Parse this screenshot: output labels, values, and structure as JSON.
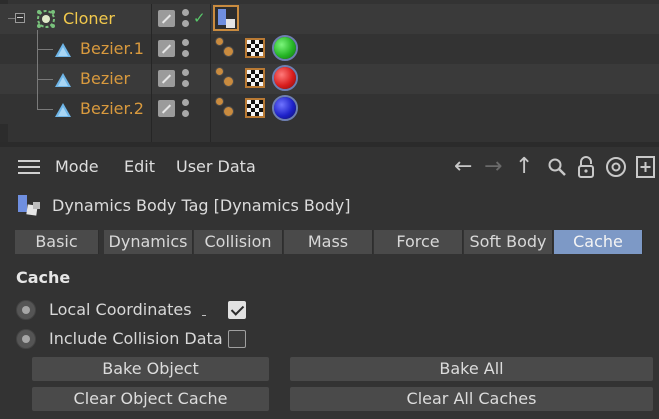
{
  "object_manager": {
    "objects": [
      {
        "name": "Cloner",
        "color": "#f2c94c",
        "icon": "cloner-icon"
      },
      {
        "name": "Bezier.1",
        "color": "#d99a3e",
        "icon": "bezier-icon",
        "material": "#26b526"
      },
      {
        "name": "Bezier",
        "color": "#d99a3e",
        "icon": "bezier-icon",
        "material": "#d91d1d"
      },
      {
        "name": "Bezier.2",
        "color": "#d99a3e",
        "icon": "bezier-icon",
        "material": "#1e22c9"
      }
    ]
  },
  "attribute_manager": {
    "menu": {
      "mode": "Mode",
      "edit": "Edit",
      "user_data": "User Data"
    },
    "nav_icons": [
      "back-arrow-icon",
      "forward-arrow-icon",
      "up-arrow-icon",
      "search-icon",
      "lock-icon",
      "target-icon",
      "new-panel-icon"
    ],
    "tag_title": "Dynamics Body Tag [Dynamics Body]",
    "tabs": [
      "Basic",
      "Dynamics",
      "Collision",
      "Mass",
      "Force",
      "Soft Body",
      "Cache"
    ],
    "active_tab": "Cache",
    "accent_color": "#7d99c6",
    "section_title": "Cache",
    "params": {
      "local_coordinates": {
        "label": "Local Coordinates",
        "checked": true
      },
      "include_collision": {
        "label": "Include Collision Data",
        "checked": false
      }
    },
    "buttons": {
      "bake_object": "Bake Object",
      "bake_all": "Bake All",
      "clear_object_cache": "Clear Object Cache",
      "clear_all_caches": "Clear All Caches"
    }
  }
}
